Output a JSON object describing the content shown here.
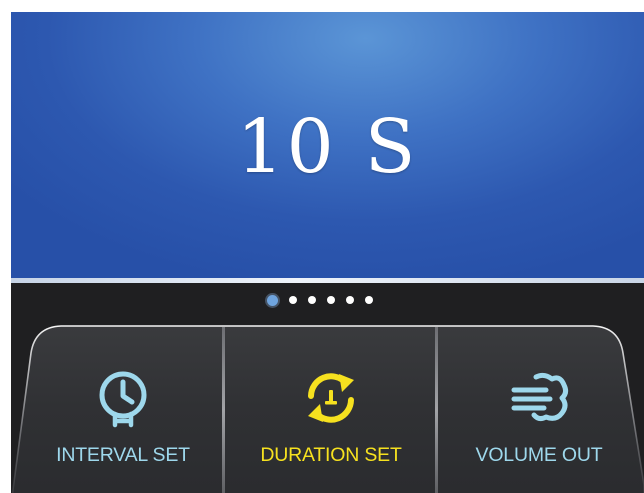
{
  "display": {
    "value": "10",
    "unit": "S"
  },
  "pagination": {
    "total": 6,
    "active_index": 0
  },
  "buttons": [
    {
      "label": "INTERVAL SET",
      "icon": "clock-timer-icon",
      "active": false
    },
    {
      "label": "DURATION SET",
      "icon": "refresh-cycle-icon",
      "active": true
    },
    {
      "label": "VOLUME OUT",
      "icon": "air-flow-icon",
      "active": false
    }
  ],
  "colors": {
    "display_blue": "#3f72c4",
    "label_inactive": "#9ed8ec",
    "label_active": "#f6e11f",
    "panel_bg": "#1f1f21"
  }
}
